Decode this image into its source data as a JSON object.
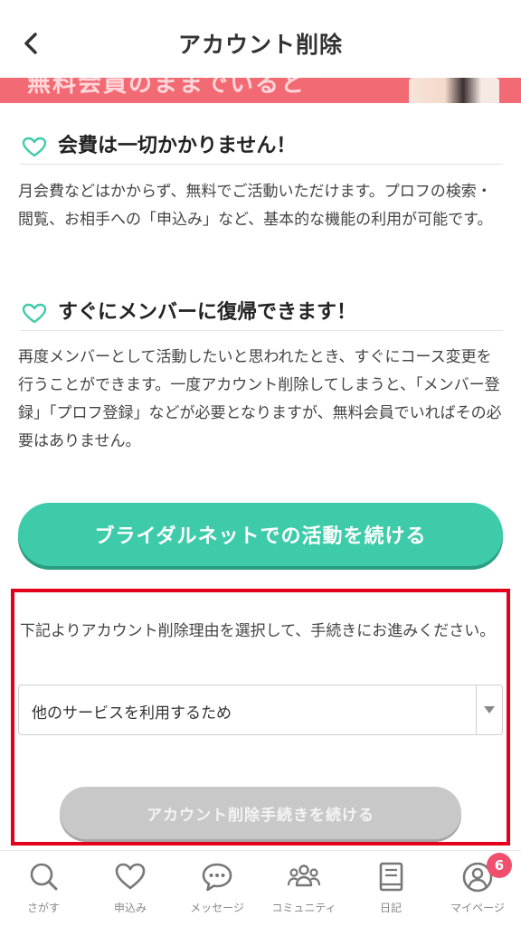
{
  "header": {
    "title": "アカウント削除"
  },
  "banner": {
    "text": "無料会員のままでいると"
  },
  "sections": [
    {
      "title": "会費は一切かかりません！",
      "body": "月会費などはかからず、無料でご活動いただけます。プロフの検索・閲覧、お相手への「申込み」など、基本的な機能の利用が可能です。"
    },
    {
      "title": "すぐにメンバーに復帰できます！",
      "body": "再度メンバーとして活動したいと思われたとき、すぐにコース変更を行うことができます。一度アカウント削除してしまうと、「メンバー登録」「プロフ登録」などが必要となりますが、無料会員でいればその必要はありません。"
    }
  ],
  "cta": {
    "label": "ブライダルネットでの活動を続ける"
  },
  "reason": {
    "instruction": "下記よりアカウント削除理由を選択して、手続きにお進みください。",
    "selected": "他のサービスを利用するため",
    "submit_label": "アカウント削除手続きを続ける"
  },
  "tabs": [
    {
      "label": "さがす",
      "icon": "search-icon"
    },
    {
      "label": "申込み",
      "icon": "heart-icon"
    },
    {
      "label": "メッセージ",
      "icon": "message-icon"
    },
    {
      "label": "コミュニティ",
      "icon": "community-icon"
    },
    {
      "label": "日記",
      "icon": "diary-icon"
    },
    {
      "label": "マイページ",
      "icon": "user-icon",
      "badge": "6"
    }
  ],
  "colors": {
    "accent": "#3ecba9",
    "banner": "#f26a73",
    "highlight": "#e4001b",
    "badge": "#f0506e"
  }
}
